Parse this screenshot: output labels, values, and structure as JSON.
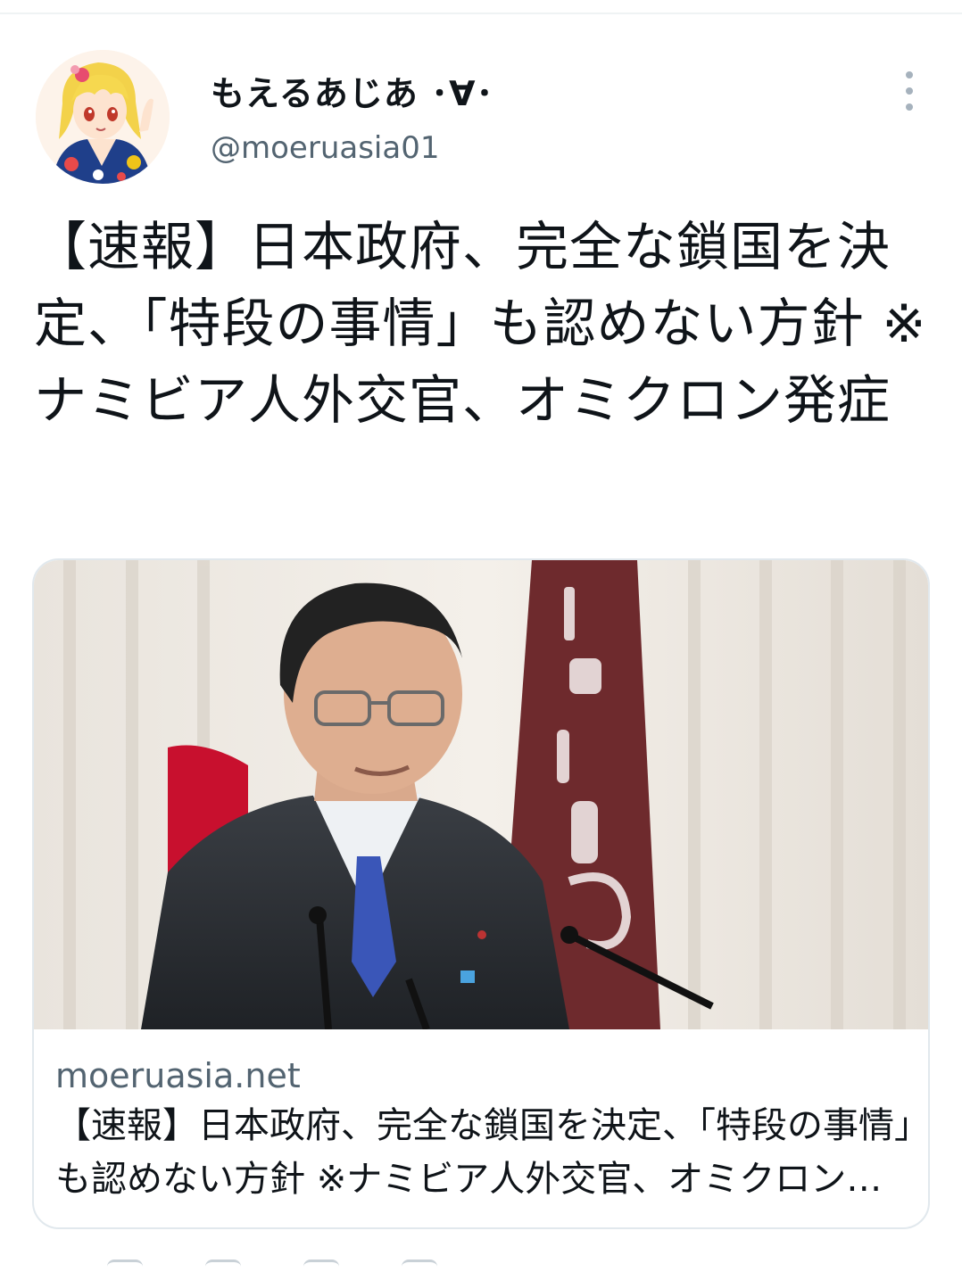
{
  "tweet": {
    "display_name": "もえるあじあ ･∀･",
    "handle": "@moeruasia01",
    "text": "【速報】日本政府、完全な鎖国を決定、「特段の事情」も認めない方針 ※ナミビア人外交官、オミクロン発症",
    "more_icon": "more-vertical-icon"
  },
  "card": {
    "domain": "moeruasia.net",
    "title": "【速報】日本政府、完全な鎖国を決定、「特段の事情」も認めない方針 ※ナミビア人外交官、オミクロン発症"
  },
  "colors": {
    "text_primary": "#0f1419",
    "text_secondary": "#536471",
    "border": "#e1e8ed",
    "banner_maroon": "#6e2a2d",
    "flag_red": "#c8102e"
  }
}
